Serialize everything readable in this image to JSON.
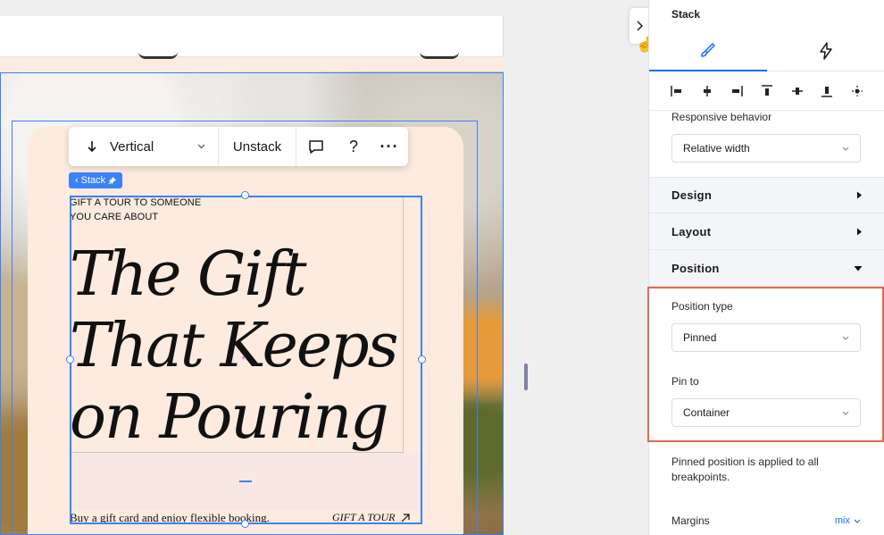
{
  "toolbar": {
    "direction_label": "Vertical",
    "unstack_label": "Unstack",
    "help_label": "?",
    "more_label": "···"
  },
  "canvas": {
    "stack_tag": "Stack",
    "eyebrow_line1": "GIFT A TOUR TO SOMEONE",
    "eyebrow_line2": "YOU CARE ABOUT",
    "headline_line1": "The Gift",
    "headline_line2": "That Keeps",
    "headline_line3": "on Pouring",
    "footer_text": "Buy a gift card and enjoy flexible booking.",
    "footer_cta": "GIFT A TOUR"
  },
  "panel": {
    "title": "Stack",
    "tabs": [
      {
        "icon": "brush-icon",
        "active": true
      },
      {
        "icon": "lightning-icon",
        "active": false
      }
    ],
    "responsive_behavior_label": "Responsive behavior",
    "responsive_behavior_value": "Relative width",
    "sections": {
      "design": "Design",
      "layout": "Layout",
      "position": "Position"
    },
    "position_type_label": "Position type",
    "position_type_value": "Pinned",
    "pin_to_label": "Pin to",
    "pin_to_value": "Container",
    "note": "Pinned position is applied to all breakpoints.",
    "margins_label": "Margins",
    "margins_value": "mix"
  },
  "colors": {
    "selection_blue": "#3b82f6",
    "accent_blue": "#116dff",
    "highlight_red": "#e8674f",
    "cream": "#fdebdf"
  }
}
